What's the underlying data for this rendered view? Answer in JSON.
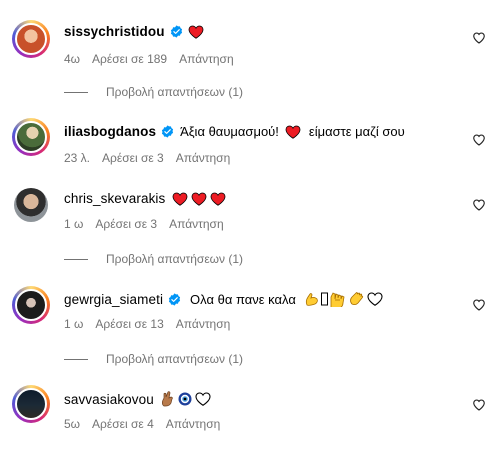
{
  "comments": [
    {
      "username": "sissychristidou",
      "verified": true,
      "text": "",
      "time": "4ω",
      "likes": "Αρέσει σε 189",
      "reply": "Απάντηση",
      "view_replies": "Προβολή απαντήσεων (1)"
    },
    {
      "username": "iliasbogdanos",
      "verified": true,
      "text": "Άξια θαυμασμού!",
      "text2": "είμαστε μαζί σου",
      "time": "23 λ.",
      "likes": "Αρέσει σε 3",
      "reply": "Απάντηση"
    },
    {
      "username": "chris_skevarakis",
      "verified": false,
      "text": "",
      "time": "1 ω",
      "likes": "Αρέσει σε 3",
      "reply": "Απάντηση",
      "view_replies": "Προβολή απαντήσεων (1)"
    },
    {
      "username": "gewrgia_siameti",
      "verified": true,
      "text": "Ολα θα πανε καλα",
      "time": "1 ω",
      "likes": "Αρέσει σε 13",
      "reply": "Απάντηση",
      "view_replies": "Προβολή απαντήσεων (1)"
    },
    {
      "username": "savvasiakovou",
      "verified": false,
      "text": "",
      "time": "5ω",
      "likes": "Αρέσει σε 4",
      "reply": "Απάντηση"
    }
  ],
  "icons": {
    "verified": "verified-badge-icon",
    "heart_red": "red-heart-emoji",
    "heart_outline": "white-heart-emoji",
    "like": "heart-outline-icon",
    "flexed_biceps": "flexed-biceps-emoji",
    "raising_hands": "raising-hands-emoji",
    "clapping_hands": "clapping-hands-emoji",
    "crossed_fingers": "crossed-fingers-emoji",
    "nazar": "nazar-amulet-emoji"
  },
  "colors": {
    "verified_blue": "#0095f6",
    "heart_red": "#ed1c24",
    "meta_gray": "#737373"
  }
}
